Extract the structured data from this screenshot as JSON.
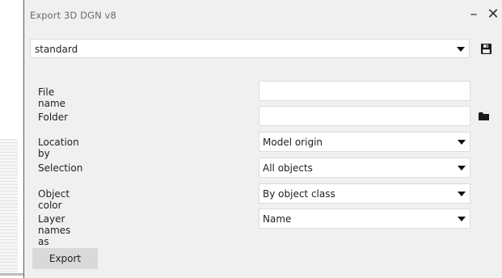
{
  "window": {
    "title": "Export 3D DGN v8",
    "minimize_glyph": "–",
    "close_glyph": "✕"
  },
  "preset": {
    "value": "standard"
  },
  "form": {
    "file_name": {
      "label": "File name",
      "value": ""
    },
    "folder": {
      "label": "Folder",
      "value": ""
    },
    "location_by": {
      "label": "Location by",
      "value": "Model origin"
    },
    "selection": {
      "label": "Selection",
      "value": "All objects"
    },
    "object_color": {
      "label": "Object color",
      "value": "By object class"
    },
    "layer_names_as": {
      "label": "Layer names as",
      "value": "Name"
    }
  },
  "actions": {
    "export_label": "Export"
  },
  "icons": {
    "save": "save-icon",
    "folder": "folder-icon",
    "dropdown": "chevron-down-icon"
  }
}
